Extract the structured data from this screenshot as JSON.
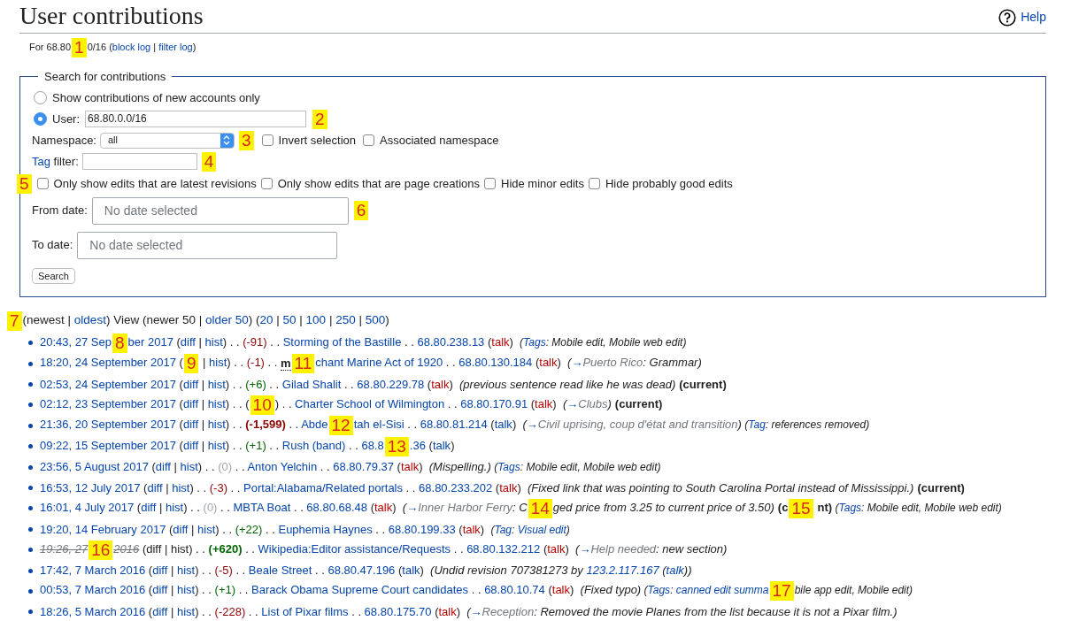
{
  "title": "User contributions",
  "help": "Help",
  "subtitle": [
    {
      "kind": "plain",
      "text": "For 68.80"
    },
    {
      "kind": "marker",
      "text": "1"
    },
    {
      "kind": "plain",
      "text": "0/16 ("
    },
    {
      "kind": "link",
      "text": "block log"
    },
    {
      "kind": "plain",
      "text": " | "
    },
    {
      "kind": "link",
      "text": "filter log"
    },
    {
      "kind": "plain",
      "text": ")"
    }
  ],
  "form": {
    "legend": "Search for contributions",
    "radios": [
      {
        "label": "Show contributions of new accounts only",
        "selected": false
      },
      {
        "label": "User:",
        "selected": true
      }
    ],
    "user_value": "68.80.0.0/16",
    "user_marker": "2",
    "namespace_label": "Namespace:",
    "namespace_value": "all",
    "namespace_marker": "3",
    "namespace_checks": [
      {
        "label": "Invert selection",
        "checked": false
      },
      {
        "label": "Associated namespace",
        "checked": false
      }
    ],
    "tag_link": "Tag",
    "tag_label": " filter:",
    "tag_marker": "4",
    "options_marker": "5",
    "options": [
      {
        "label": "Only show edits that are latest revisions",
        "checked": false
      },
      {
        "label": "Only show edits that are page creations",
        "checked": false
      },
      {
        "label": "Hide minor edits",
        "checked": false
      },
      {
        "label": "Hide probably good edits",
        "checked": false
      }
    ],
    "from_label": "From date:",
    "from_placeholder": "No date selected",
    "from_marker": "6",
    "to_label": "To date:",
    "to_placeholder": "No date selected",
    "search_button": "Search"
  },
  "nav": [
    {
      "kind": "marker",
      "text": "7"
    },
    {
      "kind": "plain",
      "text": "(newest | "
    },
    {
      "kind": "link",
      "text": "oldest"
    },
    {
      "kind": "plain",
      "text": ") View (newer 50 | "
    },
    {
      "kind": "link",
      "text": "older 50"
    },
    {
      "kind": "plain",
      "text": ") ("
    },
    {
      "kind": "link",
      "text": "20"
    },
    {
      "kind": "plain",
      "text": " | "
    },
    {
      "kind": "link",
      "text": "50"
    },
    {
      "kind": "plain",
      "text": " | "
    },
    {
      "kind": "link",
      "text": "100"
    },
    {
      "kind": "plain",
      "text": " | "
    },
    {
      "kind": "link",
      "text": "250"
    },
    {
      "kind": "plain",
      "text": " | "
    },
    {
      "kind": "link",
      "text": "500"
    },
    {
      "kind": "plain",
      "text": ")"
    }
  ],
  "rows": [
    [
      {
        "kind": "link",
        "text": "20:43, 27 Sep"
      },
      {
        "kind": "marker",
        "text": "8"
      },
      {
        "kind": "link",
        "text": "ber 2017"
      },
      {
        "kind": "plain",
        "text": " ("
      },
      {
        "kind": "link",
        "text": "diff"
      },
      {
        "kind": "plain",
        "text": " | "
      },
      {
        "kind": "link",
        "text": "hist"
      },
      {
        "kind": "plain",
        "text": ") . . "
      },
      {
        "kind": "neg",
        "text": "(-91)"
      },
      {
        "kind": "plain",
        "text": " . . "
      },
      {
        "kind": "link",
        "text": "Storming of the Bastille"
      },
      {
        "kind": "plain",
        "text": " . . "
      },
      {
        "kind": "link",
        "text": "68.80.238.13"
      },
      {
        "kind": "plain",
        "text": " ("
      },
      {
        "kind": "talk",
        "text": "talk"
      },
      {
        "kind": "plain",
        "text": ")  "
      },
      {
        "kind": "tagtext",
        "text": "("
      },
      {
        "kind": "taglink",
        "text": "Tags"
      },
      {
        "kind": "tagtext",
        "text": ": Mobile edit, Mobile web edit)"
      }
    ],
    [
      {
        "kind": "link",
        "text": "18:20, 24 September 2017"
      },
      {
        "kind": "plain",
        "text": " ("
      },
      {
        "kind": "marker",
        "text": "9"
      },
      {
        "kind": "plain",
        "text": " | "
      },
      {
        "kind": "link",
        "text": "hist"
      },
      {
        "kind": "plain",
        "text": ") . . "
      },
      {
        "kind": "neg",
        "text": "(-1)"
      },
      {
        "kind": "plain",
        "text": " . . "
      },
      {
        "kind": "minor",
        "text": "m"
      },
      {
        "kind": "marker",
        "text": "11"
      },
      {
        "kind": "link",
        "text": "chant Marine Act of 1920"
      },
      {
        "kind": "plain",
        "text": " . . "
      },
      {
        "kind": "link",
        "text": "68.80.130.184"
      },
      {
        "kind": "plain",
        "text": " ("
      },
      {
        "kind": "talk",
        "text": "talk"
      },
      {
        "kind": "plain",
        "text": ")  "
      },
      {
        "kind": "comment",
        "text": "("
      },
      {
        "kind": "arrow",
        "text": "→"
      },
      {
        "kind": "section",
        "text": "Puerto Rico"
      },
      {
        "kind": "comment",
        "text": ": Grammar)"
      }
    ],
    [
      {
        "kind": "link",
        "text": "02:53, 24 September 2017"
      },
      {
        "kind": "plain",
        "text": " ("
      },
      {
        "kind": "link",
        "text": "diff"
      },
      {
        "kind": "plain",
        "text": " | "
      },
      {
        "kind": "link",
        "text": "hist"
      },
      {
        "kind": "plain",
        "text": ") . . "
      },
      {
        "kind": "pos",
        "text": "(+6)"
      },
      {
        "kind": "plain",
        "text": " . . "
      },
      {
        "kind": "link",
        "text": "Gilad Shalit"
      },
      {
        "kind": "plain",
        "text": " . . "
      },
      {
        "kind": "link",
        "text": "68.80.229.78"
      },
      {
        "kind": "plain",
        "text": " ("
      },
      {
        "kind": "talk",
        "text": "talk"
      },
      {
        "kind": "plain",
        "text": ")  "
      },
      {
        "kind": "comment",
        "text": "(previous sentence read like he was dead)"
      },
      {
        "kind": "current",
        "text": "(current)"
      }
    ],
    [
      {
        "kind": "link",
        "text": "02:12, 23 September 2017"
      },
      {
        "kind": "plain",
        "text": " ("
      },
      {
        "kind": "link",
        "text": "diff"
      },
      {
        "kind": "plain",
        "text": " | "
      },
      {
        "kind": "link",
        "text": "hist"
      },
      {
        "kind": "plain",
        "text": ") . . ("
      },
      {
        "kind": "marker",
        "text": "10"
      },
      {
        "kind": "plain",
        "text": ") . . "
      },
      {
        "kind": "link",
        "text": "Charter School of Wilmington"
      },
      {
        "kind": "plain",
        "text": " . . "
      },
      {
        "kind": "link",
        "text": "68.80.170.91"
      },
      {
        "kind": "plain",
        "text": " ("
      },
      {
        "kind": "talk",
        "text": "talk"
      },
      {
        "kind": "plain",
        "text": ")  "
      },
      {
        "kind": "comment",
        "text": "("
      },
      {
        "kind": "arrow",
        "text": "→"
      },
      {
        "kind": "section",
        "text": "Clubs"
      },
      {
        "kind": "comment",
        "text": ")"
      },
      {
        "kind": "current",
        "text": "(current)"
      }
    ],
    [
      {
        "kind": "link",
        "text": "21:36, 20 September 2017"
      },
      {
        "kind": "plain",
        "text": " ("
      },
      {
        "kind": "link",
        "text": "diff"
      },
      {
        "kind": "plain",
        "text": " | "
      },
      {
        "kind": "link",
        "text": "hist"
      },
      {
        "kind": "plain",
        "text": ") . . "
      },
      {
        "kind": "bigneg",
        "text": "(-1,599)"
      },
      {
        "kind": "plain",
        "text": " . . "
      },
      {
        "kind": "link",
        "text": "Abde"
      },
      {
        "kind": "marker",
        "text": "12"
      },
      {
        "kind": "link",
        "text": "tah el-Sisi"
      },
      {
        "kind": "plain",
        "text": " . . "
      },
      {
        "kind": "link",
        "text": "68.80.81.214"
      },
      {
        "kind": "plain",
        "text": " ("
      },
      {
        "kind": "link",
        "text": "talk"
      },
      {
        "kind": "plain",
        "text": ")  "
      },
      {
        "kind": "comment",
        "text": "("
      },
      {
        "kind": "arrow",
        "text": "→"
      },
      {
        "kind": "section",
        "text": "Civil uprising, coup d'état and transition"
      },
      {
        "kind": "comment",
        "text": ")"
      },
      {
        "kind": "tagtext",
        "text": " ("
      },
      {
        "kind": "taglink",
        "text": "Tag"
      },
      {
        "kind": "tagtext",
        "text": ": references removed)"
      }
    ],
    [
      {
        "kind": "link",
        "text": "09:22, 15 September 2017"
      },
      {
        "kind": "plain",
        "text": " ("
      },
      {
        "kind": "link",
        "text": "diff"
      },
      {
        "kind": "plain",
        "text": " | "
      },
      {
        "kind": "link",
        "text": "hist"
      },
      {
        "kind": "plain",
        "text": ") . . "
      },
      {
        "kind": "pos",
        "text": "(+1)"
      },
      {
        "kind": "plain",
        "text": " . . "
      },
      {
        "kind": "link",
        "text": "Rush (band)"
      },
      {
        "kind": "plain",
        "text": " . . "
      },
      {
        "kind": "link",
        "text": "68.8"
      },
      {
        "kind": "marker",
        "text": "13"
      },
      {
        "kind": "link",
        "text": ".36"
      },
      {
        "kind": "plain",
        "text": " ("
      },
      {
        "kind": "link",
        "text": "talk"
      },
      {
        "kind": "plain",
        "text": ")"
      }
    ],
    [
      {
        "kind": "link",
        "text": "23:56, 5 August 2017"
      },
      {
        "kind": "plain",
        "text": " ("
      },
      {
        "kind": "link",
        "text": "diff"
      },
      {
        "kind": "plain",
        "text": " | "
      },
      {
        "kind": "link",
        "text": "hist"
      },
      {
        "kind": "plain",
        "text": ") . . "
      },
      {
        "kind": "zero",
        "text": "(0)"
      },
      {
        "kind": "plain",
        "text": " . . "
      },
      {
        "kind": "link",
        "text": "Anton Yelchin"
      },
      {
        "kind": "plain",
        "text": " . . "
      },
      {
        "kind": "link",
        "text": "68.80.79.37"
      },
      {
        "kind": "plain",
        "text": " ("
      },
      {
        "kind": "talk",
        "text": "talk"
      },
      {
        "kind": "plain",
        "text": ")  "
      },
      {
        "kind": "comment",
        "text": "(Mispelling.)"
      },
      {
        "kind": "tagtext",
        "text": " ("
      },
      {
        "kind": "taglink",
        "text": "Tags"
      },
      {
        "kind": "tagtext",
        "text": ": Mobile edit, Mobile web edit)"
      }
    ],
    [
      {
        "kind": "link",
        "text": "16:53, 12 July 2017"
      },
      {
        "kind": "plain",
        "text": " ("
      },
      {
        "kind": "link",
        "text": "diff"
      },
      {
        "kind": "plain",
        "text": " | "
      },
      {
        "kind": "link",
        "text": "hist"
      },
      {
        "kind": "plain",
        "text": ") . . "
      },
      {
        "kind": "neg",
        "text": "(-3)"
      },
      {
        "kind": "plain",
        "text": " . . "
      },
      {
        "kind": "link",
        "text": "Portal:Alabama/Related portals"
      },
      {
        "kind": "plain",
        "text": " . . "
      },
      {
        "kind": "link",
        "text": "68.80.233.202"
      },
      {
        "kind": "plain",
        "text": " ("
      },
      {
        "kind": "talk",
        "text": "talk"
      },
      {
        "kind": "plain",
        "text": ")  "
      },
      {
        "kind": "comment",
        "text": "(Fixed link that was pointing to South Carolina Portal instead of Mississippi.)"
      },
      {
        "kind": "current",
        "text": "(current)"
      }
    ],
    [
      {
        "kind": "link",
        "text": "16:01, 4 July 2017"
      },
      {
        "kind": "plain",
        "text": " ("
      },
      {
        "kind": "link",
        "text": "diff"
      },
      {
        "kind": "plain",
        "text": " | "
      },
      {
        "kind": "link",
        "text": "hist"
      },
      {
        "kind": "plain",
        "text": ") . . "
      },
      {
        "kind": "zero",
        "text": "(0)"
      },
      {
        "kind": "plain",
        "text": " . . "
      },
      {
        "kind": "link",
        "text": "MBTA Boat"
      },
      {
        "kind": "plain",
        "text": " . . "
      },
      {
        "kind": "link",
        "text": "68.80.68.48"
      },
      {
        "kind": "plain",
        "text": " ("
      },
      {
        "kind": "talk",
        "text": "talk"
      },
      {
        "kind": "plain",
        "text": ")  "
      },
      {
        "kind": "comment",
        "text": "("
      },
      {
        "kind": "arrow",
        "text": "→"
      },
      {
        "kind": "section",
        "text": "Inner Harbor Ferry"
      },
      {
        "kind": "comment",
        "text": ": C"
      },
      {
        "kind": "marker",
        "text": "14"
      },
      {
        "kind": "comment",
        "text": "ged price from 3.25 to current price of 3.50)"
      },
      {
        "kind": "current",
        "text": "(c"
      },
      {
        "kind": "marker",
        "text": "15"
      },
      {
        "kind": "current",
        "text": "nt)"
      },
      {
        "kind": "tagtext",
        "text": " ("
      },
      {
        "kind": "taglink",
        "text": "Tags"
      },
      {
        "kind": "tagtext",
        "text": ": Mobile edit, Mobile web edit)"
      }
    ],
    [
      {
        "kind": "link",
        "text": "19:20, 14 February 2017"
      },
      {
        "kind": "plain",
        "text": " ("
      },
      {
        "kind": "link",
        "text": "diff"
      },
      {
        "kind": "plain",
        "text": " | "
      },
      {
        "kind": "link",
        "text": "hist"
      },
      {
        "kind": "plain",
        "text": ") . . "
      },
      {
        "kind": "pos",
        "text": "(+22)"
      },
      {
        "kind": "plain",
        "text": " . . "
      },
      {
        "kind": "link",
        "text": "Euphemia Haynes"
      },
      {
        "kind": "plain",
        "text": " . . "
      },
      {
        "kind": "link",
        "text": "68.80.199.33"
      },
      {
        "kind": "plain",
        "text": " ("
      },
      {
        "kind": "talk",
        "text": "talk"
      },
      {
        "kind": "plain",
        "text": ")  "
      },
      {
        "kind": "tagtext",
        "text": "("
      },
      {
        "kind": "taglink",
        "text": "Tag"
      },
      {
        "kind": "tagtext",
        "text": ": "
      },
      {
        "kind": "taglink",
        "text": "Visual edit"
      },
      {
        "kind": "tagtext",
        "text": ")"
      }
    ],
    [
      {
        "kind": "struck",
        "text": "19:26, 27"
      },
      {
        "kind": "marker",
        "text": "16"
      },
      {
        "kind": "struck",
        "text": "2016"
      },
      {
        "kind": "plain",
        "text": " (diff | hist) . . "
      },
      {
        "kind": "bigpos",
        "text": "(+620)"
      },
      {
        "kind": "plain",
        "text": " . . "
      },
      {
        "kind": "link",
        "text": "Wikipedia:Editor assistance/Requests"
      },
      {
        "kind": "plain",
        "text": " . . "
      },
      {
        "kind": "link",
        "text": "68.80.132.212"
      },
      {
        "kind": "plain",
        "text": " ("
      },
      {
        "kind": "talk",
        "text": "talk"
      },
      {
        "kind": "plain",
        "text": ")  "
      },
      {
        "kind": "comment",
        "text": "("
      },
      {
        "kind": "arrow",
        "text": "→"
      },
      {
        "kind": "section",
        "text": "Help needed"
      },
      {
        "kind": "comment",
        "text": ": new section)"
      }
    ],
    [
      {
        "kind": "link",
        "text": "17:42, 7 March 2016"
      },
      {
        "kind": "plain",
        "text": " ("
      },
      {
        "kind": "link",
        "text": "diff"
      },
      {
        "kind": "plain",
        "text": " | "
      },
      {
        "kind": "link",
        "text": "hist"
      },
      {
        "kind": "plain",
        "text": ") . . "
      },
      {
        "kind": "neg",
        "text": "(-5)"
      },
      {
        "kind": "plain",
        "text": " . . "
      },
      {
        "kind": "link",
        "text": "Beale Street"
      },
      {
        "kind": "plain",
        "text": " . . "
      },
      {
        "kind": "link",
        "text": "68.80.47.196"
      },
      {
        "kind": "plain",
        "text": " ("
      },
      {
        "kind": "link",
        "text": "talk"
      },
      {
        "kind": "plain",
        "text": ")  "
      },
      {
        "kind": "comment",
        "text": "(Undid revision 707381273 by "
      },
      {
        "kind": "ilink",
        "text": "123.2.117.167"
      },
      {
        "kind": "comment",
        "text": " ("
      },
      {
        "kind": "ilink",
        "text": "talk"
      },
      {
        "kind": "comment",
        "text": "))"
      }
    ],
    [
      {
        "kind": "link",
        "text": "00:53, 7 March 2016"
      },
      {
        "kind": "plain",
        "text": " ("
      },
      {
        "kind": "link",
        "text": "diff"
      },
      {
        "kind": "plain",
        "text": " | "
      },
      {
        "kind": "link",
        "text": "hist"
      },
      {
        "kind": "plain",
        "text": ") . . "
      },
      {
        "kind": "pos",
        "text": "(+1)"
      },
      {
        "kind": "plain",
        "text": " . . "
      },
      {
        "kind": "link",
        "text": "Barack Obama Supreme Court candidates"
      },
      {
        "kind": "plain",
        "text": " . . "
      },
      {
        "kind": "link",
        "text": "68.80.10.74"
      },
      {
        "kind": "plain",
        "text": " ("
      },
      {
        "kind": "talk",
        "text": "talk"
      },
      {
        "kind": "plain",
        "text": ")  "
      },
      {
        "kind": "comment",
        "text": "(Fixed typo)"
      },
      {
        "kind": "tagtext",
        "text": " ("
      },
      {
        "kind": "taglink",
        "text": "Tags"
      },
      {
        "kind": "tagtext",
        "text": ": "
      },
      {
        "kind": "taglink",
        "text": "canned edit summa"
      },
      {
        "kind": "marker",
        "text": "17"
      },
      {
        "kind": "tagtext",
        "text": "bile app edit, Mobile edit)"
      }
    ],
    [
      {
        "kind": "link",
        "text": "18:26, 5 March 2016"
      },
      {
        "kind": "plain",
        "text": " ("
      },
      {
        "kind": "link",
        "text": "diff"
      },
      {
        "kind": "plain",
        "text": " | "
      },
      {
        "kind": "link",
        "text": "hist"
      },
      {
        "kind": "plain",
        "text": ") . . "
      },
      {
        "kind": "neg",
        "text": "(-228)"
      },
      {
        "kind": "plain",
        "text": " . . "
      },
      {
        "kind": "link",
        "text": "List of Pixar films"
      },
      {
        "kind": "plain",
        "text": " . . "
      },
      {
        "kind": "link",
        "text": "68.80.175.70"
      },
      {
        "kind": "plain",
        "text": " ("
      },
      {
        "kind": "talk",
        "text": "talk"
      },
      {
        "kind": "plain",
        "text": ")  "
      },
      {
        "kind": "comment",
        "text": "("
      },
      {
        "kind": "arrow",
        "text": "→"
      },
      {
        "kind": "section",
        "text": "Reception"
      },
      {
        "kind": "comment",
        "text": ": Removed the movie Planes from the list because it is not a Pixar film.)"
      }
    ]
  ]
}
